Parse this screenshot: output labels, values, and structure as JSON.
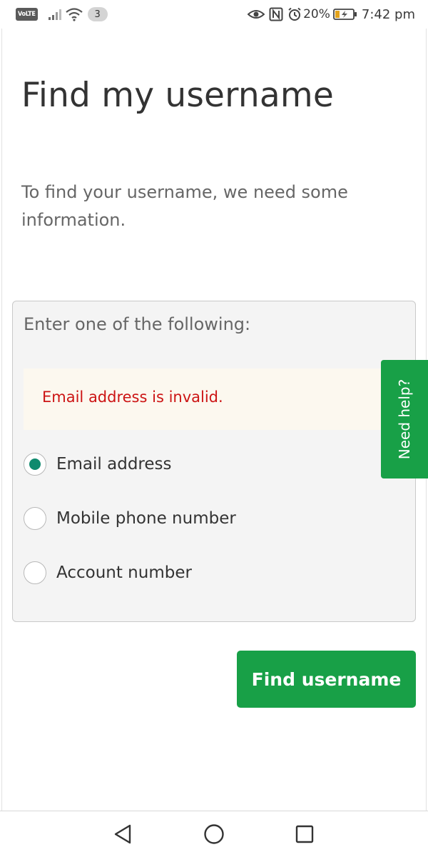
{
  "status_bar": {
    "volte": "VoLTE",
    "notification_count": "3",
    "battery_percent": "20%",
    "time": "7:42 pm",
    "icons": [
      "signal-icon",
      "wifi-icon",
      "eye-icon",
      "nfc-icon",
      "alarm-icon",
      "battery-icon"
    ]
  },
  "page": {
    "title": "Find my username",
    "intro": "To find your username, we need some information."
  },
  "panel": {
    "heading": "Enter one of the following:",
    "error": "Email address is invalid.",
    "options": [
      {
        "label": "Email address",
        "selected": true
      },
      {
        "label": "Mobile phone number",
        "selected": false
      },
      {
        "label": "Account number",
        "selected": false
      }
    ]
  },
  "actions": {
    "find_username": "Find username"
  },
  "help_tab": {
    "label": "Need help?"
  },
  "colors": {
    "accent_green": "#18a047",
    "radio_selected": "#0f8a6e",
    "error_red": "#cc1414",
    "error_bg": "#fcf8ef"
  },
  "nav_bar": {
    "icons": [
      "back-icon",
      "home-icon",
      "recents-icon"
    ]
  }
}
